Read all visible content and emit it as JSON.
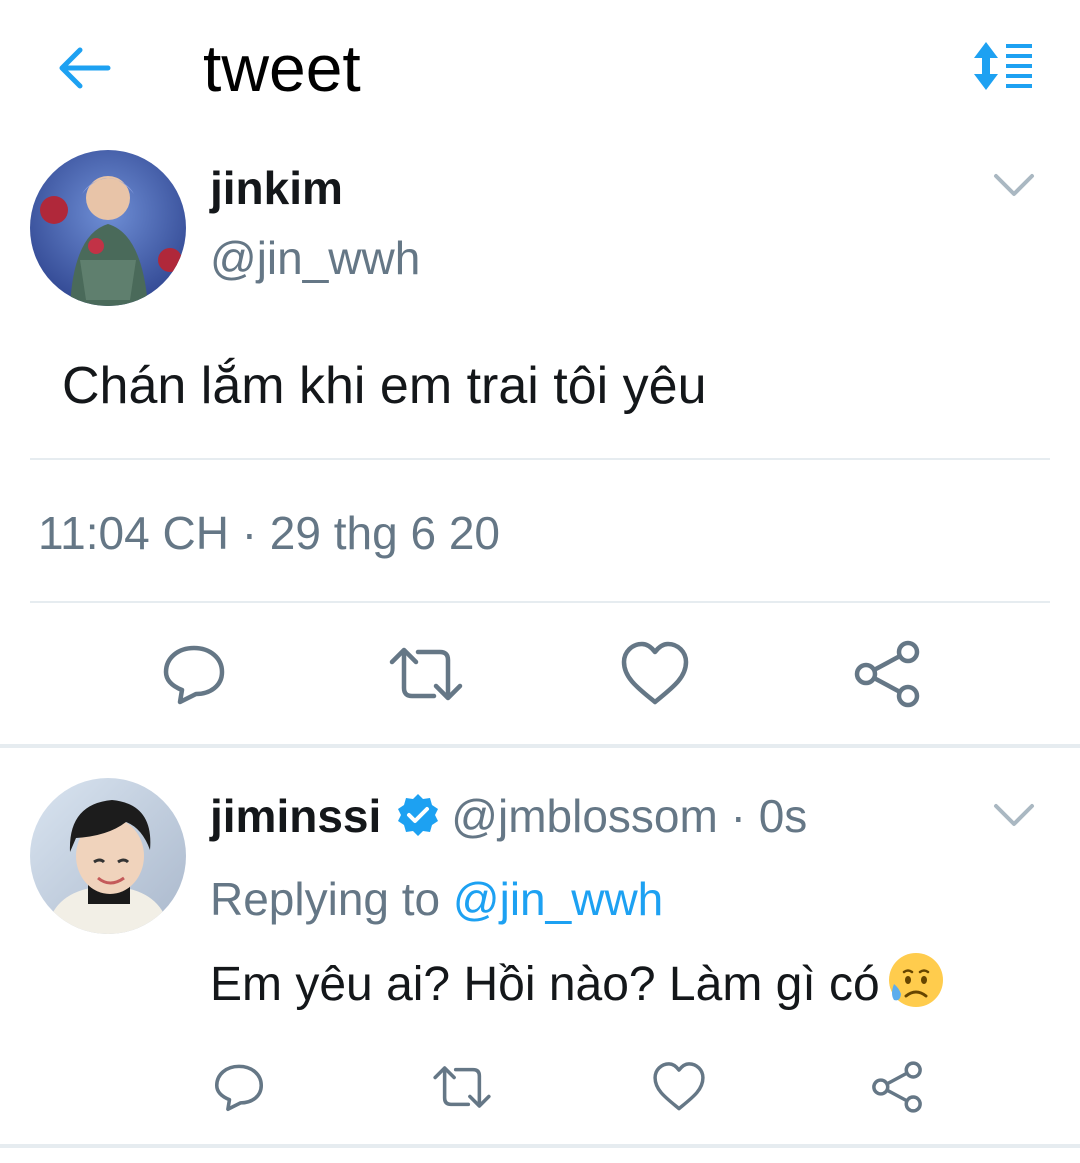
{
  "header": {
    "title": "tweet",
    "back_icon": "arrow-left-icon",
    "sort_icon": "sort-list-icon",
    "accent": "#1da1f2"
  },
  "main_tweet": {
    "display_name": "jinkim",
    "handle": "@jin_wwh",
    "text": "Chán lắm khi em trai tôi yêu",
    "timestamp": "11:04 CH · 29 thg 6 20",
    "actions": [
      "reply-icon",
      "retweet-icon",
      "like-icon",
      "share-icon"
    ]
  },
  "reply_tweet": {
    "display_name": "jiminssi",
    "verified": true,
    "handle_time": "@jmblossom · 0s",
    "replying_prefix": "Replying to ",
    "replying_handle": "@jin_wwh",
    "text": "Em yêu ai? Hồi nào? Làm gì có",
    "emoji": "sad-but-relieved-face-emoji",
    "actions": [
      "reply-icon",
      "retweet-icon",
      "like-icon",
      "share-icon"
    ]
  },
  "colors": {
    "primary_text": "#14171a",
    "secondary_text": "#657786",
    "divider": "#e6ecf0",
    "link": "#1da1f2",
    "icon_gray": "#657786"
  }
}
